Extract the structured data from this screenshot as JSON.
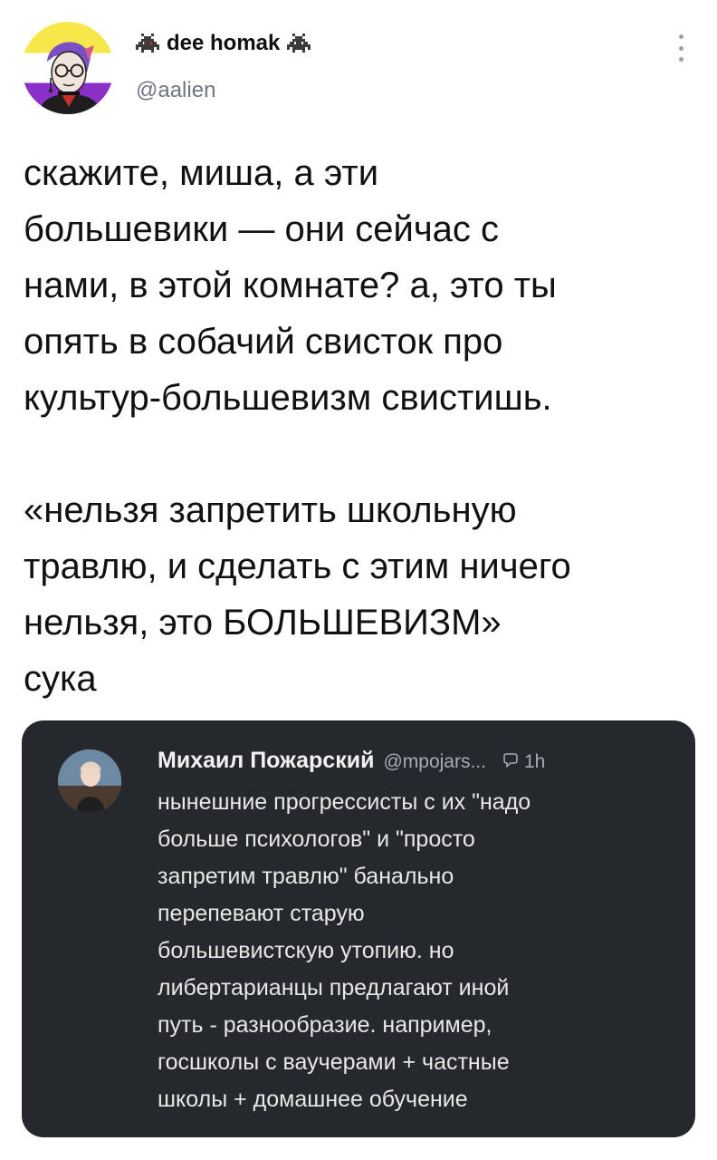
{
  "tweet": {
    "author_name": "dee homak",
    "author_handle": "@aalien",
    "name_icon": "alien-icon",
    "body": "скажите, миша, а эти\nбольшевики — они сейчас с\nнами, в этой комнате? а, это ты\nопять в собачий свисток про\nкультур-большевизм свистишь.\n\n«нельзя запретить школьную\nтравлю, и сделать с этим ничего\nнельзя, это БОЛЬШЕВИЗМ»\nсука"
  },
  "quoted": {
    "author_name": "Михаил Пожарский",
    "author_handle": "@mpojars...",
    "time": "1h",
    "body": "нынешние прогрессисты с их \"надо\nбольше психологов\" и \"просто\nзапретим травлю\" банально\nперепевают старую\nбольшевистскую утопию. но\nлибертарианцы предлагают иной\nпуть - разнообразие. например,\nгосшколы с ваучерами + частные\nшколы + домашнее обучение"
  },
  "colors": {
    "quote_card_bg": "#25282c",
    "flag_yellow": "#f6e84a",
    "flag_purple": "#8b2fc9"
  }
}
